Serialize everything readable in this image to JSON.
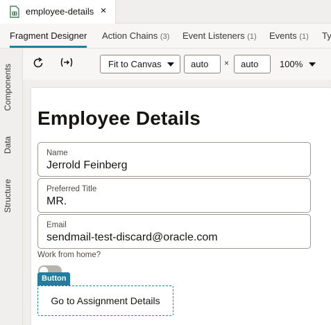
{
  "file_tab": {
    "name": "employee-details",
    "icon": "fragment-file-icon",
    "close": "×"
  },
  "subtabs": [
    {
      "label": "Fragment Designer",
      "count": ""
    },
    {
      "label": "Action Chains",
      "count": "(3)"
    },
    {
      "label": "Event Listeners",
      "count": "(1)"
    },
    {
      "label": "Events",
      "count": "(1)"
    },
    {
      "label": "Ty",
      "count": ""
    }
  ],
  "left_panel": {
    "components": "Components",
    "data": "Data",
    "structure": "Structure"
  },
  "toolbar": {
    "refresh_icon": "refresh-icon",
    "expand_icon": "expand-width-icon",
    "fit_label": "Fit to Canvas",
    "width_value": "auto",
    "times": "×",
    "height_value": "auto",
    "zoom": "100%"
  },
  "canvas": {
    "title": "Employee Details",
    "fields": [
      {
        "label": "Name",
        "value": "Jerrold Feinberg"
      },
      {
        "label": "Preferred Title",
        "value": "MR."
      },
      {
        "label": "Email",
        "value": "sendmail-test-discard@oracle.com"
      }
    ],
    "work_from_home_label": "Work from home?",
    "component_tag": "Button",
    "button_label": "Go to Assignment Details"
  },
  "colors": {
    "accent": "#227e9e",
    "file_icon": "#4c825c"
  }
}
